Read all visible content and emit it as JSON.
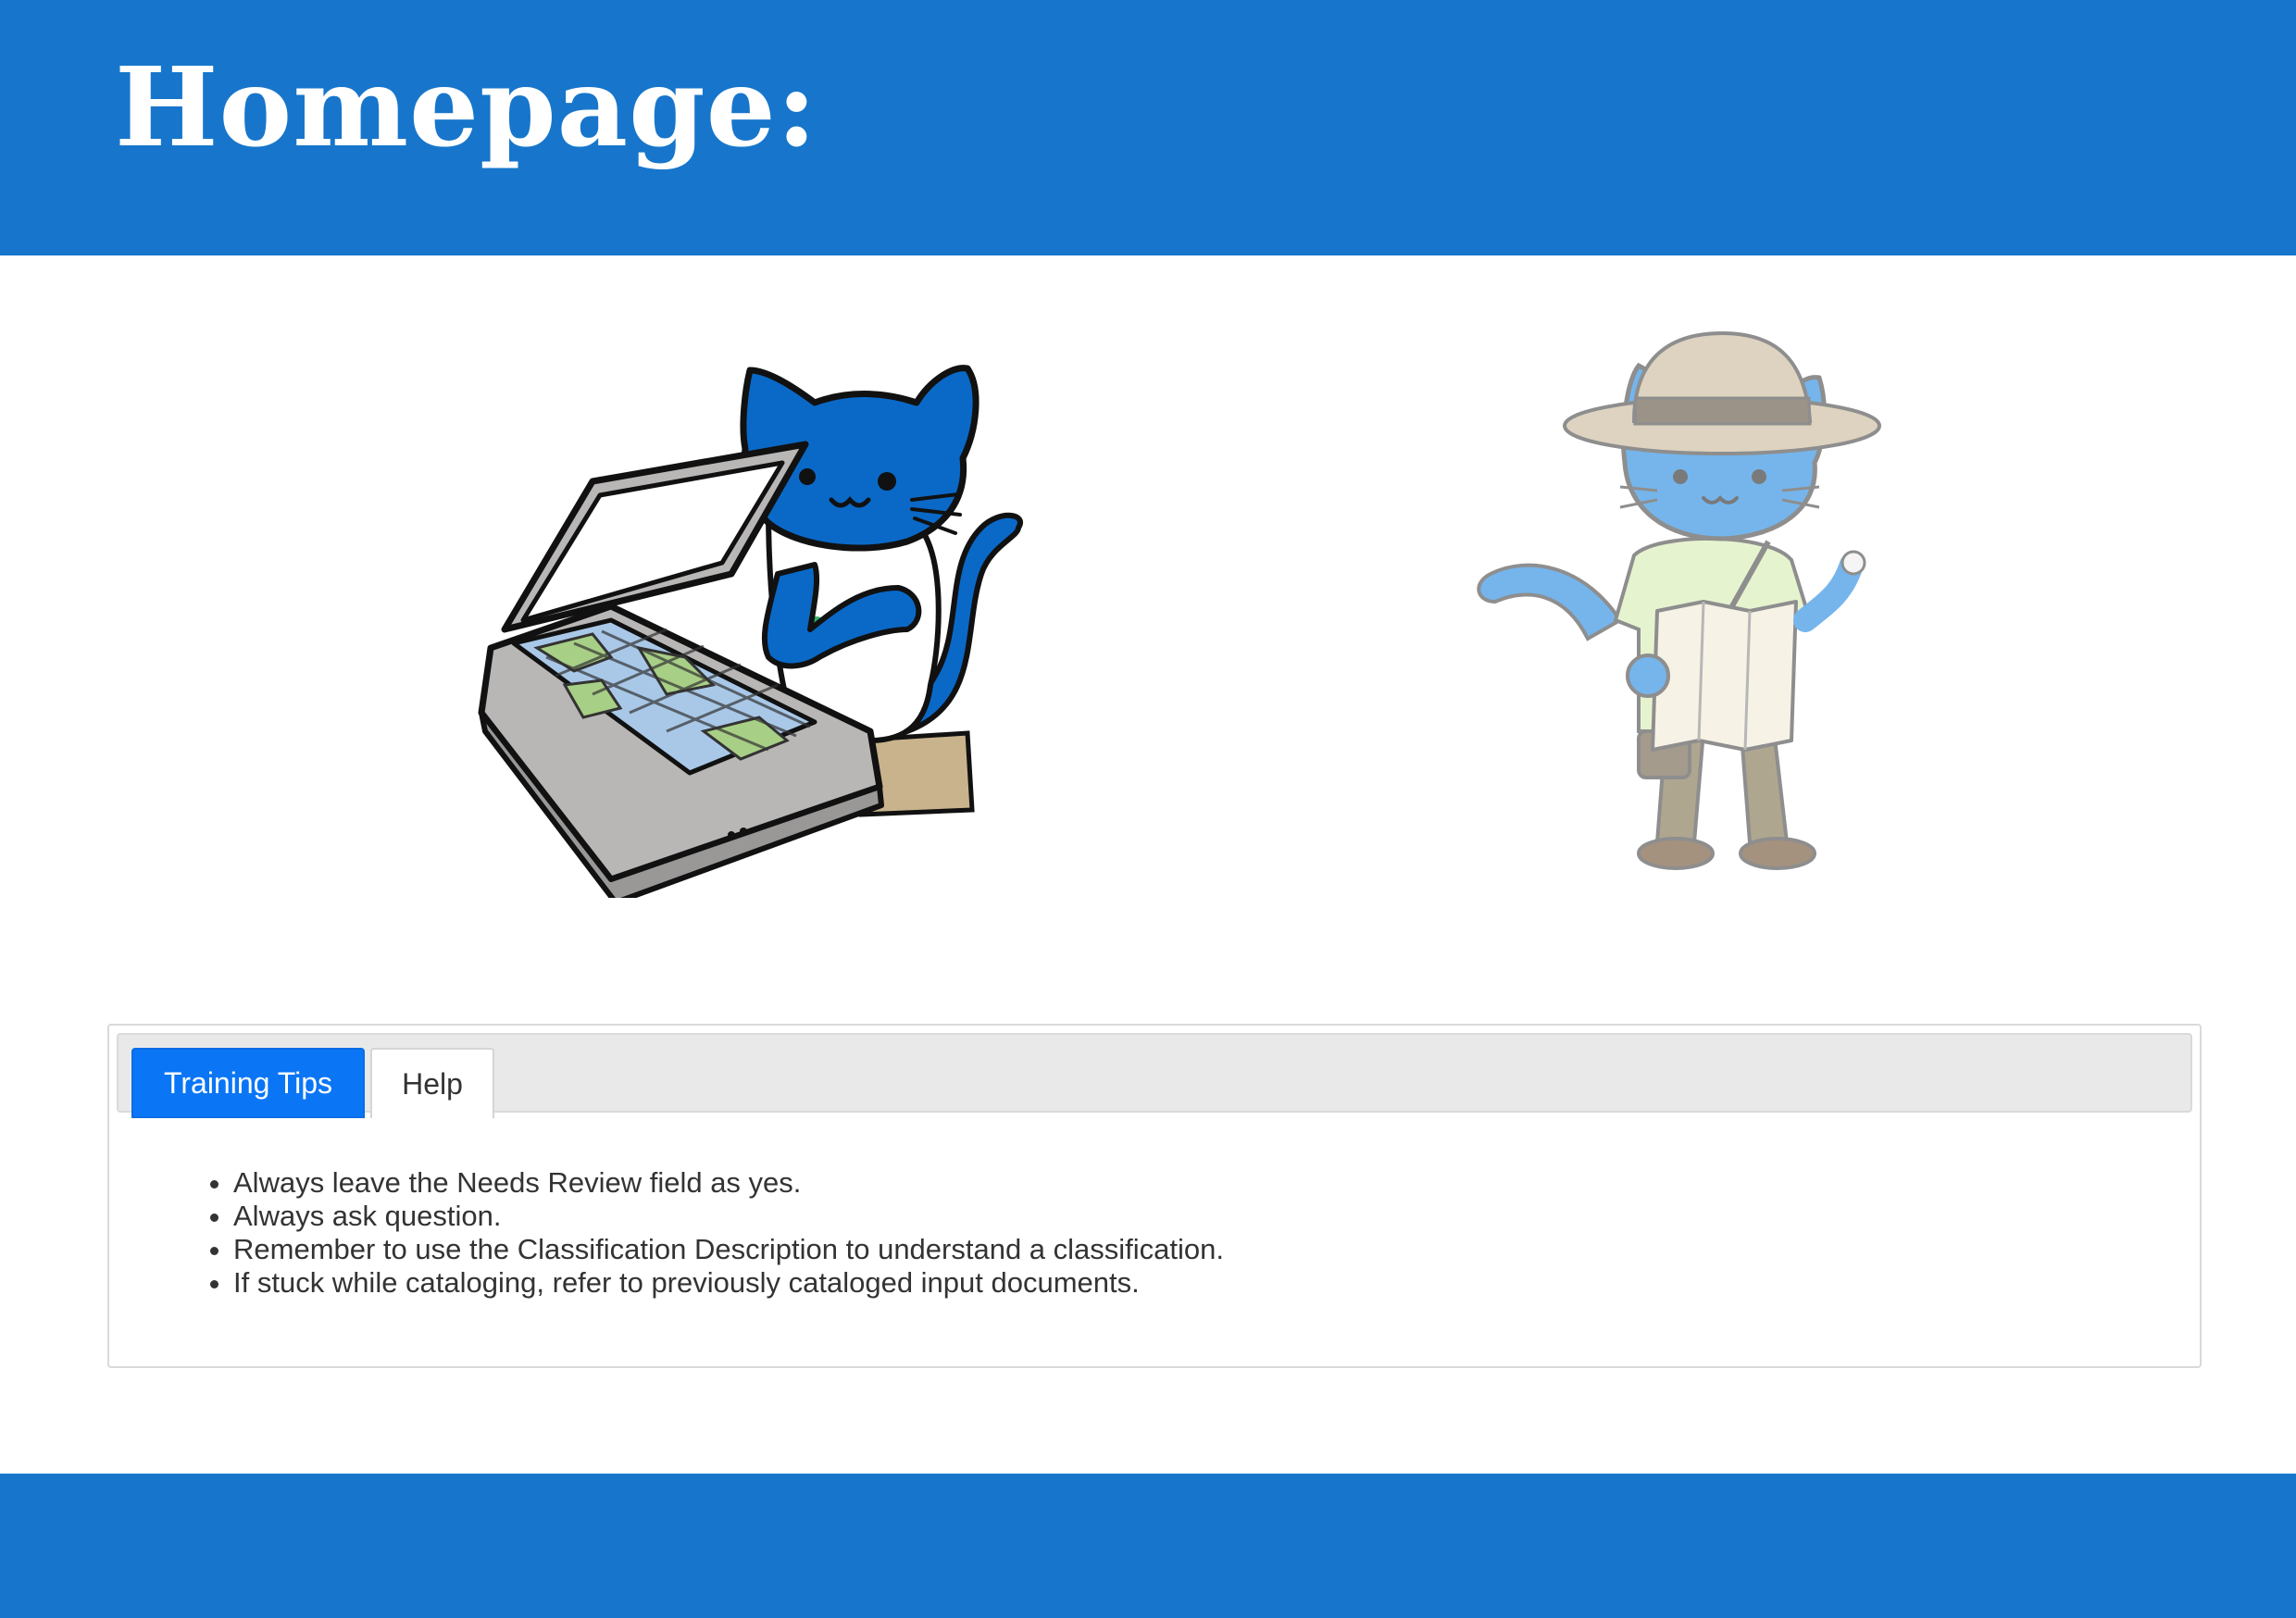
{
  "header": {
    "title": "Homepage:"
  },
  "colors": {
    "banner": "#1776cb",
    "active_tab": "#0a76f6"
  },
  "illustrations": [
    {
      "icon": "cat-scanning-map-illustration"
    },
    {
      "icon": "cat-explorer-with-map-illustration"
    }
  ],
  "panel": {
    "tabs": [
      {
        "label": "Training Tips",
        "active": true
      },
      {
        "label": "Help",
        "active": false
      }
    ],
    "tips": [
      "Always leave the Needs Review field as yes.",
      "Always ask question.",
      "Remember to use the Classification Description to understand a classification.",
      "If stuck while cataloging, refer to previously cataloged input documents."
    ]
  }
}
